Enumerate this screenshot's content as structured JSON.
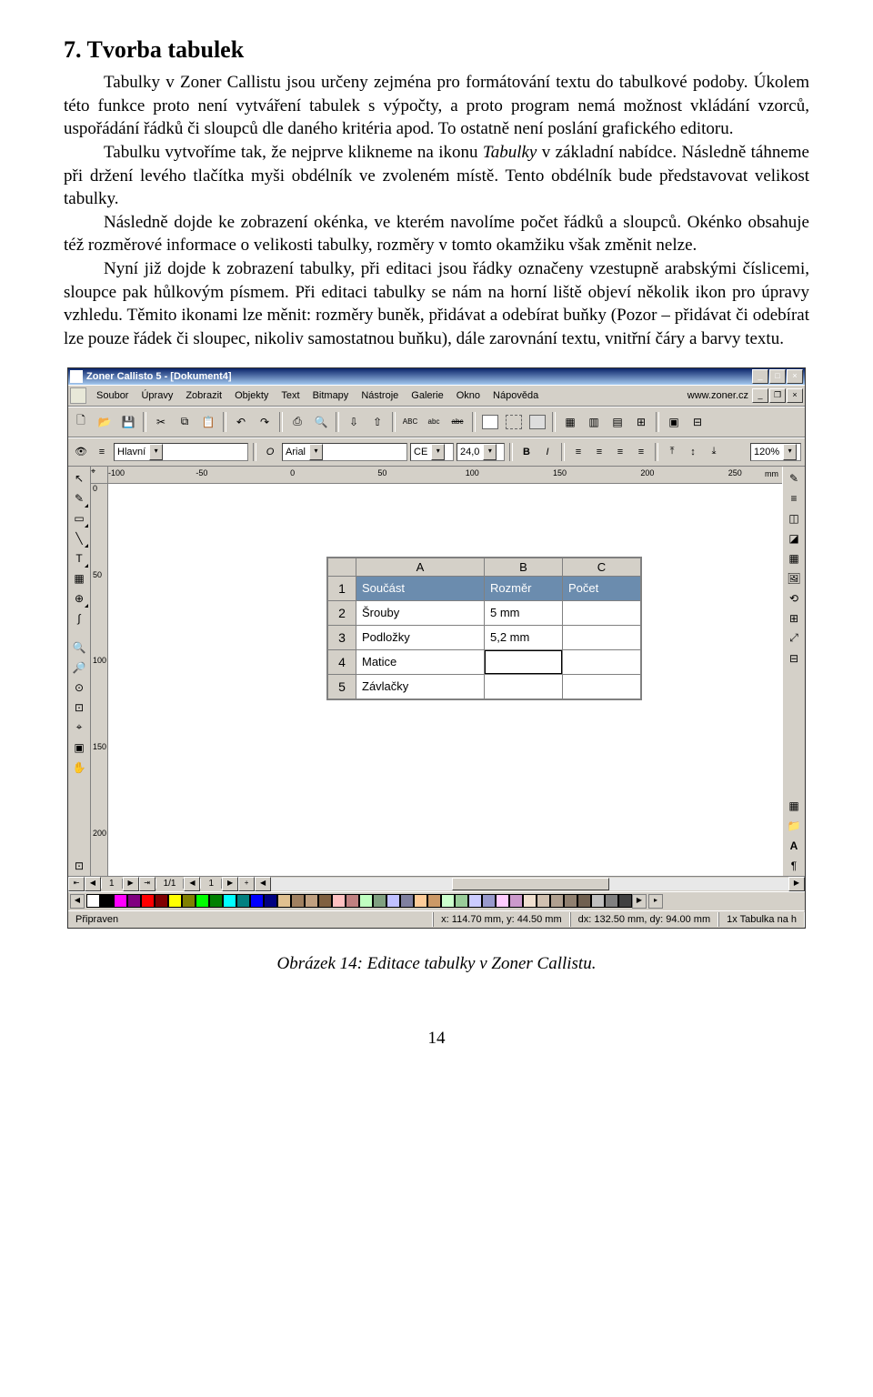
{
  "doc": {
    "heading": "7. Tvorba tabulek",
    "p1": "Tabulky v Zoner Callistu jsou určeny zejména pro formátování textu do tabulkové podoby. Úkolem této funkce proto není vytváření tabulek s výpočty, a proto program nemá možnost vkládání vzorců, uspořádání řádků či sloupců dle daného kritéria apod. To ostatně není poslání grafického editoru.",
    "p2a": "Tabulku vytvoříme tak, že nejprve klikneme na ikonu ",
    "p2b": "Tabulky",
    "p2c": " v základní nabídce. Následně táhneme při držení levého tlačítka myši obdélník ve zvoleném místě. Tento obdélník bude představovat velikost tabulky.",
    "p3": "Následně dojde ke zobrazení okénka, ve kterém navolíme počet řádků a sloupců. Okénko obsahuje též rozměrové informace o velikosti tabulky, rozměry v tomto okamžiku však změnit nelze.",
    "p4": "Nyní již dojde k zobrazení tabulky, při editaci jsou řádky označeny vzestupně arabskými číslicemi, sloupce pak hůlkovým písmem. Při editaci tabulky se nám na horní liště objeví několik ikon pro úpravy vzhledu. Těmito ikonami lze měnit: rozměry buněk, přidávat a odebírat buňky (Pozor – přidávat či odebírat lze pouze řádek či sloupec, nikoliv samostatnou buňku), dále zarovnání textu, vnitřní čáry a barvy textu.",
    "caption": "Obrázek 14: Editace tabulky v Zoner Callistu.",
    "pagenum": "14"
  },
  "app": {
    "title": "Zoner Callisto 5 - [Dokument4]",
    "menus": [
      "Soubor",
      "Úpravy",
      "Zobrazit",
      "Objekty",
      "Text",
      "Bitmapy",
      "Nástroje",
      "Galerie",
      "Okno",
      "Nápověda"
    ],
    "url": "www.zoner.cz",
    "layer": "Hlavní",
    "font": "Arial",
    "encoding": "CE",
    "fontsize": "24,0",
    "zoom": "120%",
    "ruler_unit": "mm",
    "hruler": [
      "-100",
      "-50",
      "0",
      "50",
      "100",
      "150",
      "200",
      "250"
    ],
    "vruler": [
      "0",
      "50",
      "100",
      "150",
      "200"
    ],
    "nav": {
      "page_a": "1",
      "page_b": "1/1",
      "page_c": "1"
    },
    "table": {
      "cols": [
        "A",
        "B",
        "C"
      ],
      "rows": [
        "1",
        "2",
        "3",
        "4",
        "5"
      ],
      "data": [
        [
          "Součást",
          "Rozměr",
          "Počet"
        ],
        [
          "Šrouby",
          "5 mm",
          ""
        ],
        [
          "Podložky",
          "5,2 mm",
          ""
        ],
        [
          "Matice",
          "",
          ""
        ],
        [
          "Závlačky",
          "",
          ""
        ]
      ]
    },
    "status": {
      "ready": "Připraven",
      "xy": "x: 114.70 mm, y: 44.50 mm",
      "dxdy": "dx: 132.50 mm, dy: 94.00 mm",
      "obj": "1x Tabulka na h"
    },
    "colors": [
      "#ffffff",
      "#000000",
      "#ff00ff",
      "#800080",
      "#ff0000",
      "#800000",
      "#ffff00",
      "#808000",
      "#00ff00",
      "#008000",
      "#00ffff",
      "#008080",
      "#0000ff",
      "#000080",
      "#e0c090",
      "#a08060",
      "#c0a080",
      "#806040",
      "#ffc0c0",
      "#c08080",
      "#c0ffc0",
      "#80a080",
      "#c0c0ff",
      "#8080a0",
      "#ffcc99",
      "#cc9966",
      "#ccffcc",
      "#99cc99",
      "#ccccff",
      "#9999cc",
      "#ffccff",
      "#cc99cc",
      "#f0e0d0",
      "#d0c0b0",
      "#b0a090",
      "#908070",
      "#706050",
      "#c0c0c0",
      "#808080",
      "#404040"
    ]
  }
}
